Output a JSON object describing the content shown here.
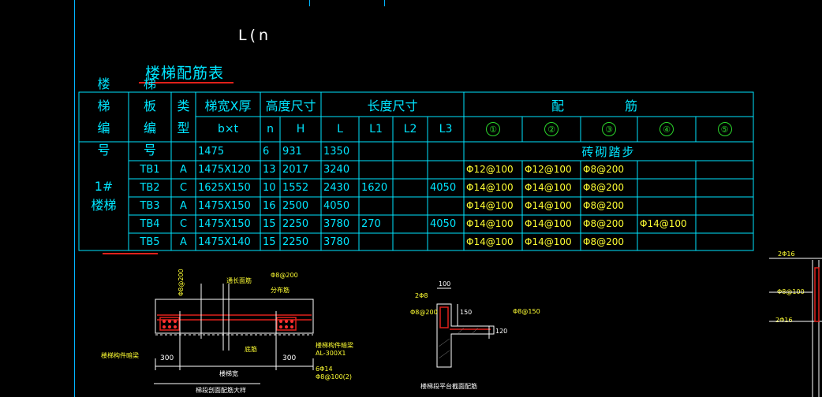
{
  "page_marker": "L(n",
  "table": {
    "title": "楼梯配筋表",
    "headers": {
      "stair_no": "楼梯编号",
      "slab_no": "梯板编号",
      "type": "类型",
      "width_thick": "梯宽X厚",
      "width_thick_sub": "b×t",
      "height_dim": "高度尺寸",
      "n": "n",
      "H": "H",
      "length_dim": "长度尺寸",
      "L": "L",
      "L1": "L1",
      "L2": "L2",
      "L3": "L3",
      "reinforcement": "配 筋",
      "circles": [
        "①",
        "②",
        "③",
        "④",
        "⑤"
      ]
    },
    "stair_label": "1#楼梯",
    "first_row": {
      "bt": "1475",
      "n": "6",
      "H": "931",
      "L": "1350",
      "note": "砖砌踏步"
    },
    "rows": [
      {
        "slab": "TB1",
        "type": "A",
        "bt": "1475X120",
        "n": "13",
        "H": "2017",
        "L": "3240",
        "L1": "",
        "L2": "",
        "L3": "",
        "r1": "Φ12@100",
        "r2": "Φ12@100",
        "r3": "Φ8@200",
        "r4": "",
        "r5": ""
      },
      {
        "slab": "TB2",
        "type": "C",
        "bt": "1625X150",
        "n": "10",
        "H": "1552",
        "L": "2430",
        "L1": "1620",
        "L2": "",
        "L3": "4050",
        "r1": "Φ14@100",
        "r2": "Φ14@100",
        "r3": "Φ8@200",
        "r4": "",
        "r5": ""
      },
      {
        "slab": "TB3",
        "type": "A",
        "bt": "1475X150",
        "n": "16",
        "H": "2500",
        "L": "4050",
        "L1": "",
        "L2": "",
        "L3": "",
        "r1": "Φ14@100",
        "r2": "Φ14@100",
        "r3": "Φ8@200",
        "r4": "",
        "r5": ""
      },
      {
        "slab": "TB4",
        "type": "C",
        "bt": "1475X150",
        "n": "15",
        "H": "2250",
        "L": "3780",
        "L1": "270",
        "L2": "",
        "L3": "4050",
        "r1": "Φ14@100",
        "r2": "Φ14@100",
        "r3": "Φ8@200",
        "r4": "Φ14@100",
        "r5": ""
      },
      {
        "slab": "TB5",
        "type": "A",
        "bt": "1475X140",
        "n": "15",
        "H": "2250",
        "L": "3780",
        "L1": "",
        "L2": "",
        "L3": "",
        "r1": "Φ14@100",
        "r2": "Φ14@100",
        "r3": "Φ8@200",
        "r4": "",
        "r5": ""
      }
    ]
  },
  "detail1": {
    "top_label": "通长面筋",
    "right_top": "Φ8@200",
    "dist_label": "分布筋",
    "left_vert": "Φ8@200",
    "bottom_bar": "底筋",
    "left_note": "楼梯构件暗梁",
    "dim_left": "300",
    "dim_right": "300",
    "mid_label": "楼梯宽",
    "right_note1": "楼梯构件暗梁",
    "right_note2": "AL-300X1",
    "right_note3": "6Φ14",
    "right_note4": "Φ8@100(2)",
    "caption": "梯段剖面配筋大样"
  },
  "detail2": {
    "dim_top": "100",
    "label1": "2Φ8",
    "label2": "Φ8@200",
    "dim_side": "150",
    "label3": "Φ8@150",
    "dim_bottom": "120",
    "caption": "楼梯段平台截面配筋"
  },
  "detail3": {
    "label1": "2Φ16",
    "label2": "Φ8@100",
    "label3": "2Φ16"
  },
  "colors": {
    "table_line": "#00e5ff",
    "text_yellow": "#ffff33",
    "marker_red": "#e0201a",
    "circle_green": "#2bd62b"
  }
}
